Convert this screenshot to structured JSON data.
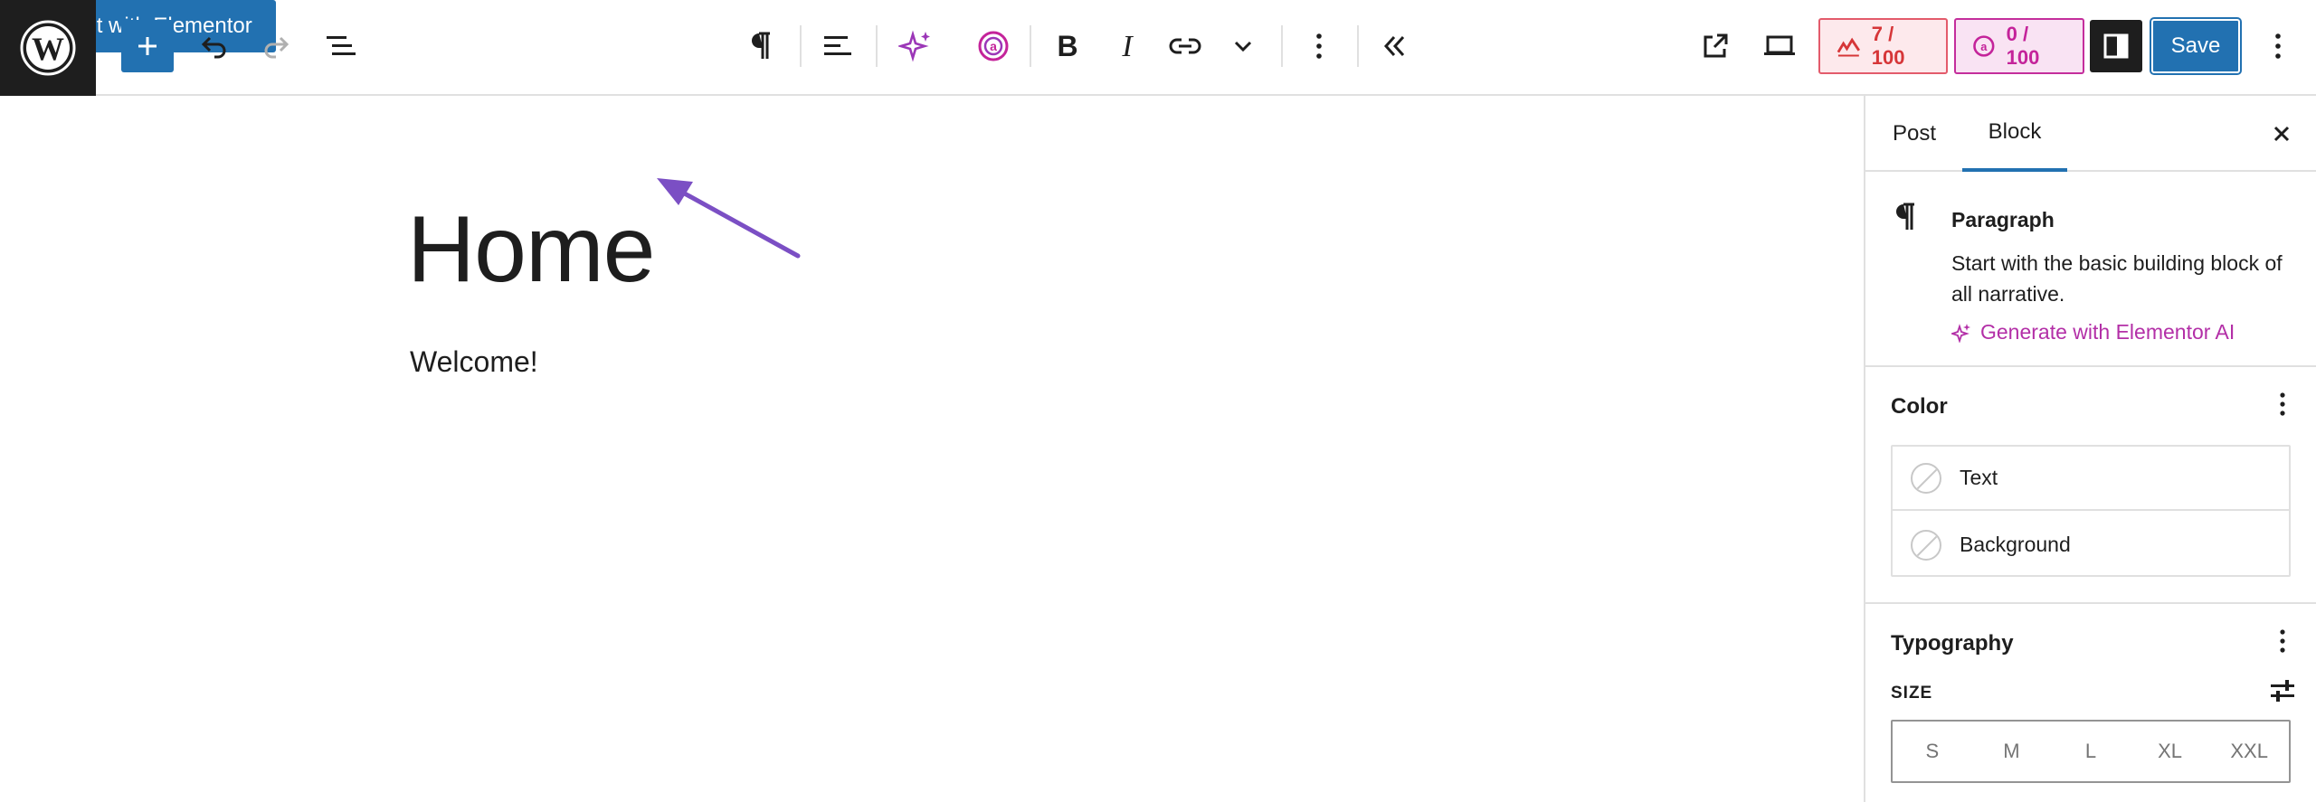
{
  "toolbar": {
    "edit_with_elementor_label": "Edit with Elementor",
    "score_seo": "7 / 100",
    "score_readability": "0 / 100",
    "save_label": "Save"
  },
  "canvas": {
    "title": "Home",
    "paragraph": "Welcome!"
  },
  "sidebar": {
    "tabs": [
      {
        "label": "Post"
      },
      {
        "label": "Block"
      }
    ],
    "block": {
      "name": "Paragraph",
      "description": "Start with the basic building block of all narrative.",
      "generate_ai_label": "Generate with Elementor AI"
    },
    "color": {
      "title": "Color",
      "items": [
        {
          "label": "Text"
        },
        {
          "label": "Background"
        }
      ]
    },
    "typography": {
      "title": "Typography",
      "size_label": "SIZE",
      "size_options": [
        "S",
        "M",
        "L",
        "XL",
        "XXL"
      ]
    }
  },
  "colors": {
    "accent": "#2271b1",
    "elementor_ai": "#b32fa7",
    "score_red": "#d63638",
    "score_pink": "#c4239a",
    "annotation_arrow": "#7b4fc4"
  }
}
